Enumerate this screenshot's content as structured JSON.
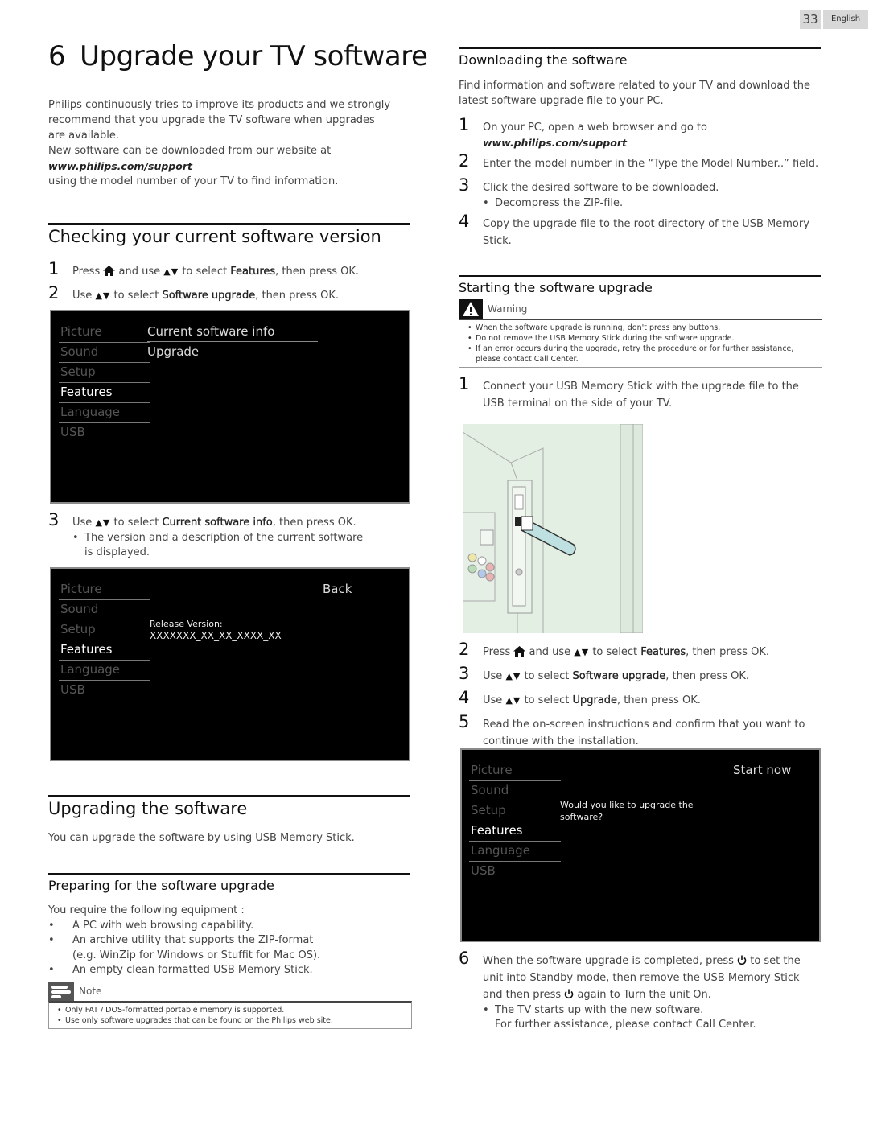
{
  "page": {
    "number": "33",
    "language": "English"
  },
  "chapter": {
    "number": "6",
    "title": "Upgrade your TV software",
    "intro": [
      "Philips continuously tries to improve its products and we strongly recommend that you upgrade the TV software when upgrades are available.",
      "New software can be downloaded from our website at",
      "www.philips.com/support",
      "using the model number of your TV to find information."
    ]
  },
  "checking": {
    "heading": "Checking your current software version",
    "steps": [
      {
        "num": "1",
        "pre": "Press",
        "mid": "and use",
        "post": "to select",
        "bold": "Features",
        "end": ", then press OK."
      },
      {
        "num": "2",
        "pre": "Use",
        "post": "to select",
        "bold": "Software upgrade",
        "end": ", then press OK."
      },
      {
        "num": "3",
        "pre": "Use",
        "post": "to select",
        "bold": "Current software info",
        "end": ", then press OK."
      }
    ],
    "step3_bullet": "The version and a description of the current software is displayed.",
    "screen1": {
      "menu": [
        "Picture",
        "Sound",
        "Setup",
        "Features",
        "Language",
        "USB"
      ],
      "options": [
        "Current software info",
        "Upgrade"
      ]
    },
    "screen2": {
      "menu": [
        "Picture",
        "Sound",
        "Setup",
        "Features",
        "Language",
        "USB"
      ],
      "back_label": "Back",
      "release_label": "Release Version:",
      "release_value": "XXXXXXX_XX_XX_XXXX_XX"
    }
  },
  "upgrading": {
    "heading": "Upgrading the software",
    "text": "You can upgrade the software by using USB Memory Stick."
  },
  "preparing": {
    "heading": "Preparing for the software upgrade",
    "intro": "You require the following equipment :",
    "items": [
      "A PC with web browsing capability.",
      "An archive utility that supports the ZIP-format",
      "(e.g. WinZip for Windows or Stuffit for Mac OS).",
      "An empty clean formatted USB Memory Stick."
    ],
    "note_label": "Note",
    "notes": [
      "Only FAT / DOS-formatted portable memory is supported.",
      "Use only software upgrades that can be found on the Philips web site."
    ]
  },
  "downloading": {
    "heading": "Downloading the software",
    "intro": "Find information and software related to your TV and download the latest software upgrade file to your PC.",
    "steps": [
      {
        "num": "1",
        "text": "On your PC, open a web browser and go to",
        "url": "www.philips.com/support"
      },
      {
        "num": "2",
        "text": "Enter the model number in the “Type the Model Number..” field."
      },
      {
        "num": "3",
        "text": "Click the desired software to be downloaded.",
        "bullet": "Decompress the ZIP-file."
      },
      {
        "num": "4",
        "text": "Copy the upgrade file to the root directory of the USB Memory Stick."
      }
    ]
  },
  "starting": {
    "heading": "Starting the software upgrade",
    "warning_label": "Warning",
    "warnings": [
      "When the software upgrade is running, don't press any buttons.",
      "Do not remove the USB Memory Stick during the software upgrade.",
      "If an error occurs during the upgrade, retry the procedure or for further assistance, please contact Call Center."
    ],
    "steps": [
      {
        "num": "1",
        "text": "Connect your USB Memory Stick with the upgrade file to the USB terminal on the side of your TV."
      },
      {
        "num": "2",
        "pre": "Press",
        "mid": "and use",
        "post": "to select",
        "bold": "Features",
        "end": ", then press OK."
      },
      {
        "num": "3",
        "pre": "Use",
        "post": "to select",
        "bold": "Software upgrade",
        "end": ", then press OK."
      },
      {
        "num": "4",
        "pre": "Use",
        "post": "to select",
        "bold": "Upgrade",
        "end": ", then press OK."
      },
      {
        "num": "5",
        "text": "Read the on-screen instructions and confirm that you want to continue with the installation."
      },
      {
        "num": "6",
        "a": "When the software upgrade is completed, press",
        "b": "to set the unit into Standby mode, then remove the USB Memory Stick and then press",
        "c": "again to Turn the unit On."
      }
    ],
    "step6_bullet": "The TV starts up with the new software.",
    "step6_extra": "For further assistance, please contact Call Center.",
    "screen3": {
      "menu": [
        "Picture",
        "Sound",
        "Setup",
        "Features",
        "Language",
        "USB"
      ],
      "start_label": "Start now",
      "question": "Would you like to upgrade the software?"
    },
    "illustration": "usb-stick-inserted-into-tv-side-terminal"
  },
  "symbols": {
    "updown": "▲▼",
    "bullet": "•"
  }
}
